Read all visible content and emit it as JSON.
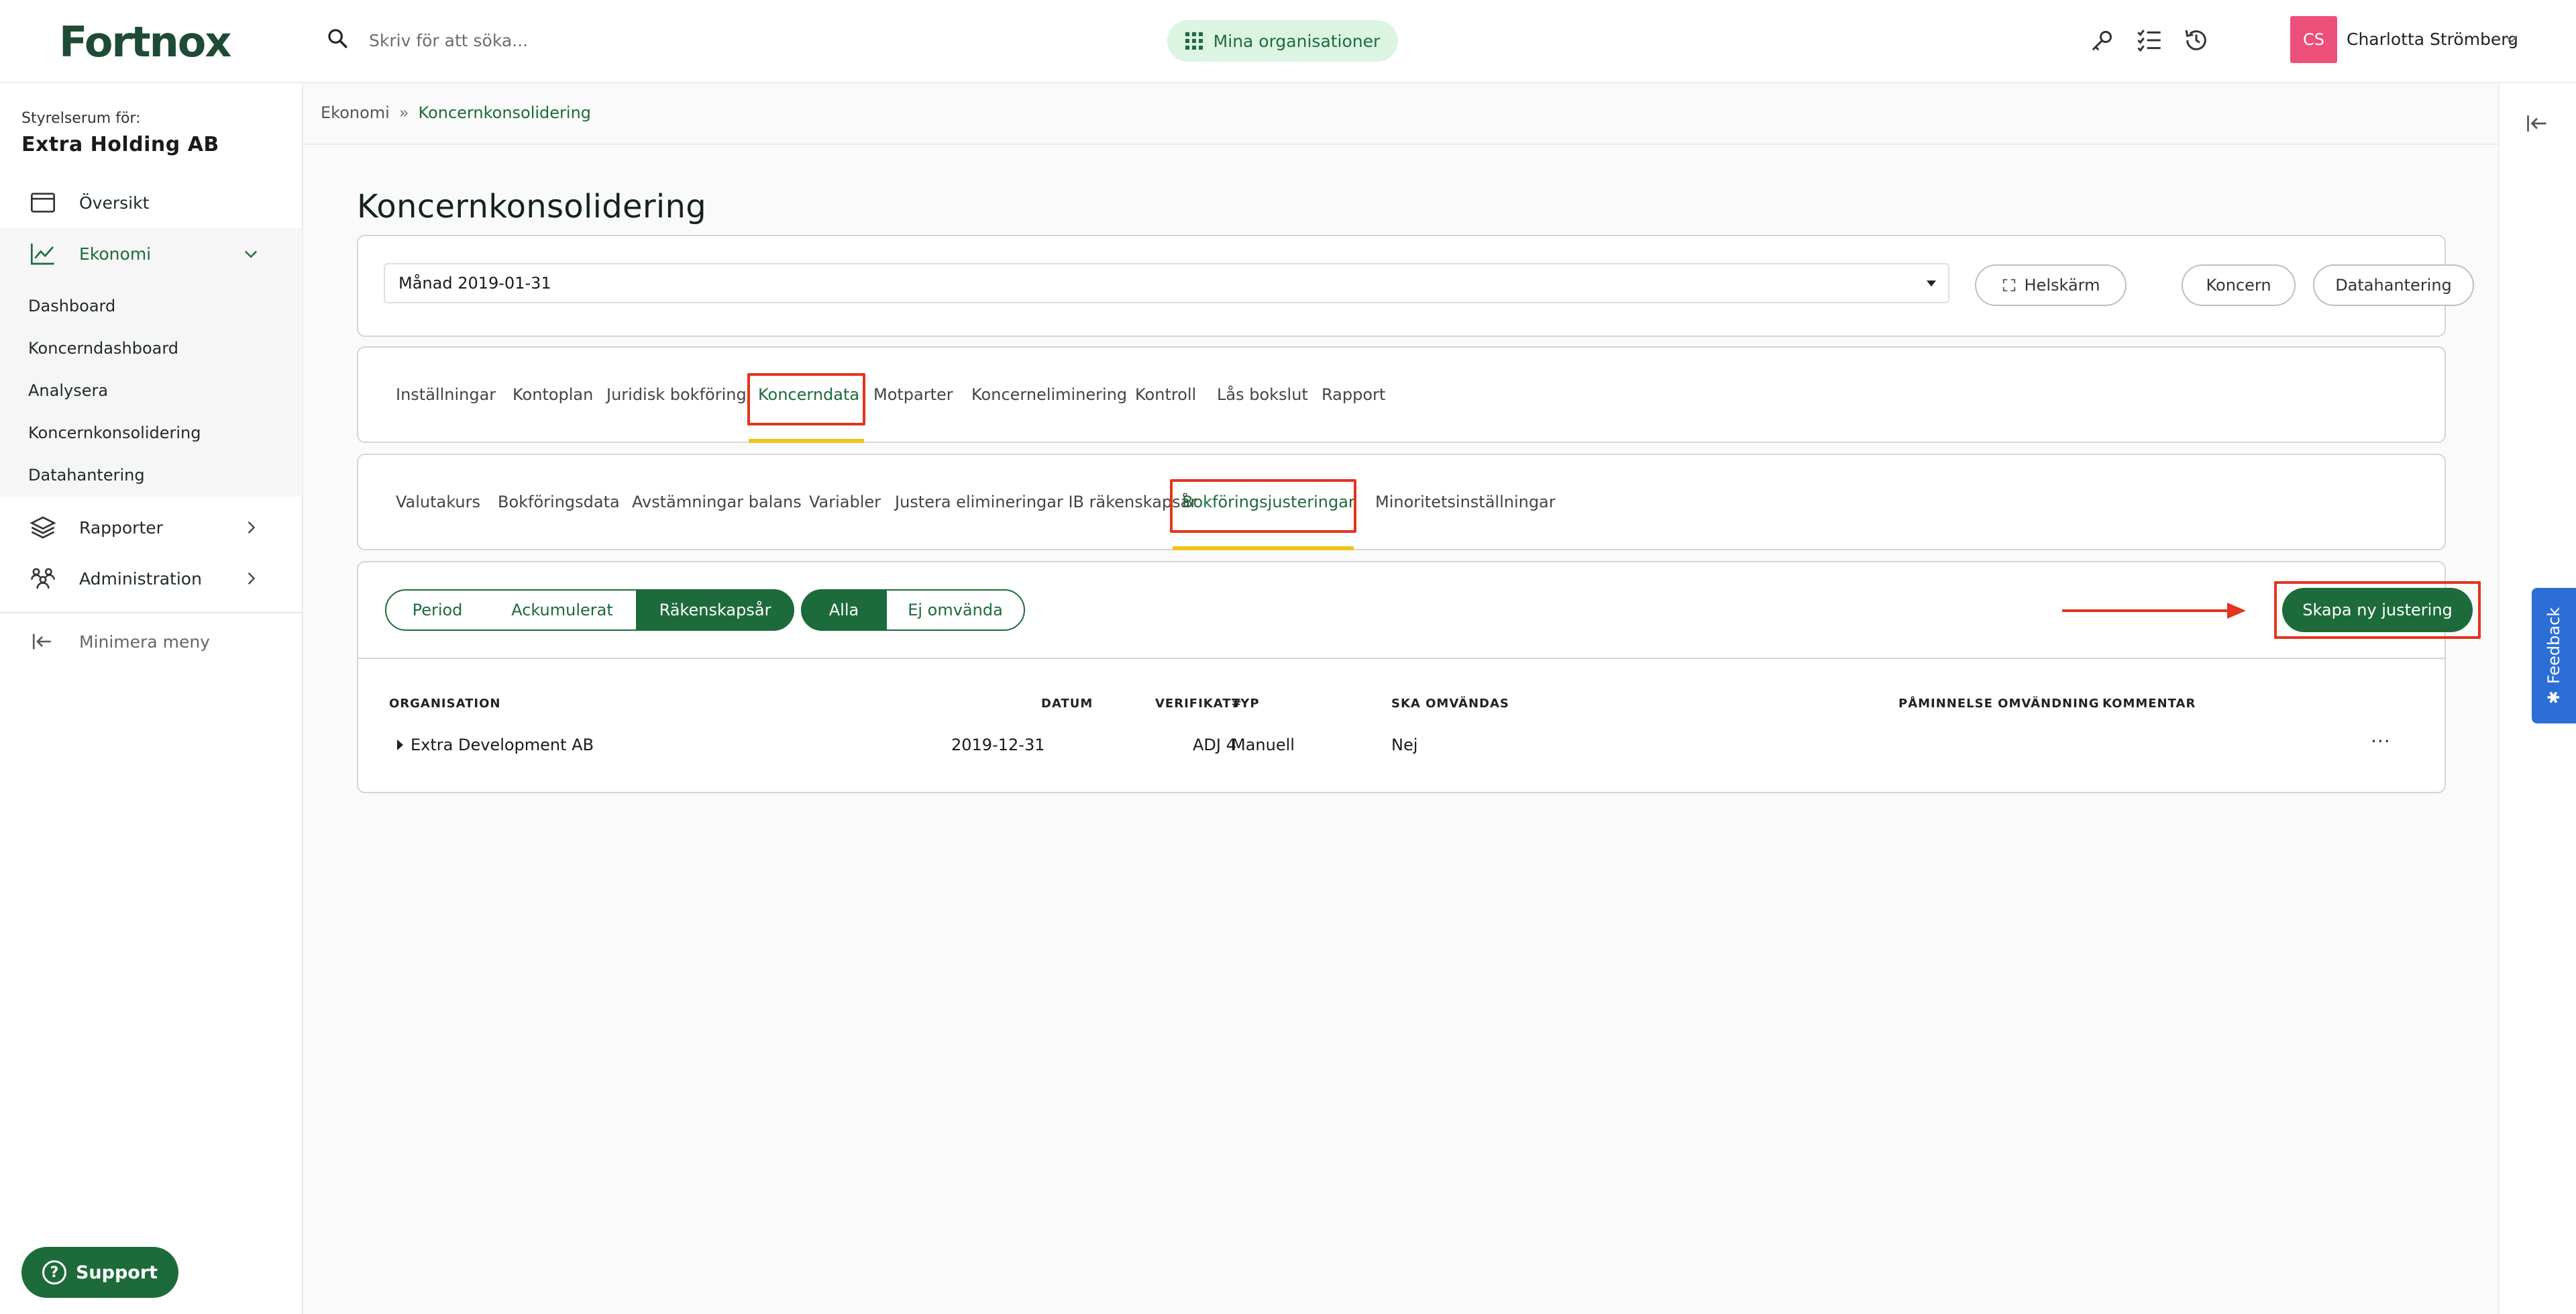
{
  "app": {
    "logo": "Fortnox"
  },
  "header": {
    "search_placeholder": "Skriv för att söka...",
    "org_button": "Mina organisationer",
    "user_initials": "CS",
    "user_name": "Charlotta Strömberg"
  },
  "sidebar": {
    "label": "Styrelserum för:",
    "org": "Extra Holding AB",
    "overview": "Översikt",
    "economy": "Ekonomi",
    "economy_sub": [
      "Dashboard",
      "Koncerndashboard",
      "Analysera",
      "Koncernkonsolidering",
      "Datahantering"
    ],
    "reports": "Rapporter",
    "administration": "Administration",
    "minimize": "Minimera meny",
    "support": "Support"
  },
  "breadcrumb": {
    "parent": "Ekonomi",
    "current": "Koncernkonsolidering"
  },
  "page": {
    "title": "Koncernkonsolidering"
  },
  "toolbar": {
    "period": "Månad 2019-01-31",
    "fullscreen": "Helskärm",
    "group": "Koncern",
    "data_management": "Datahantering"
  },
  "tabs_main": [
    "Inställningar",
    "Kontoplan",
    "Juridisk bokföring",
    "Koncerndata",
    "Motparter",
    "Koncerneliminering",
    "Kontroll",
    "Lås bokslut",
    "Rapport"
  ],
  "tabs_sub": [
    "Valutakurs",
    "Bokföringsdata",
    "Avstämningar balans",
    "Variabler",
    "Justera elimineringar IB räkenskapsår",
    "Bokföringsjusteringar",
    "Minoritetsinställningar"
  ],
  "filters": {
    "period": "Period",
    "accumulated": "Ackumulerat",
    "fiscal_year": "Räkenskapsår",
    "all": "Alla",
    "not_reversed": "Ej omvända"
  },
  "create_button": "Skapa ny justering",
  "table": {
    "headers": {
      "organisation": "ORGANISATION",
      "date": "DATUM",
      "voucher": "VERIFIKAT#",
      "type": "TYP",
      "reverse": "SKA OMVÄNDAS",
      "reminder": "PÅMINNELSE OMVÄNDNING",
      "comment": "KOMMENTAR"
    },
    "rows": [
      {
        "organisation": "Extra Development AB",
        "date": "2019-12-31",
        "voucher": "ADJ 4",
        "type": "Manuell",
        "reverse": "Nej"
      }
    ]
  },
  "feedback": "Feedback",
  "colors": {
    "brand": "#1d6b3b",
    "highlight": "#e5331f",
    "tab_underline": "#f2c21b",
    "feedback": "#2b6fd6"
  }
}
